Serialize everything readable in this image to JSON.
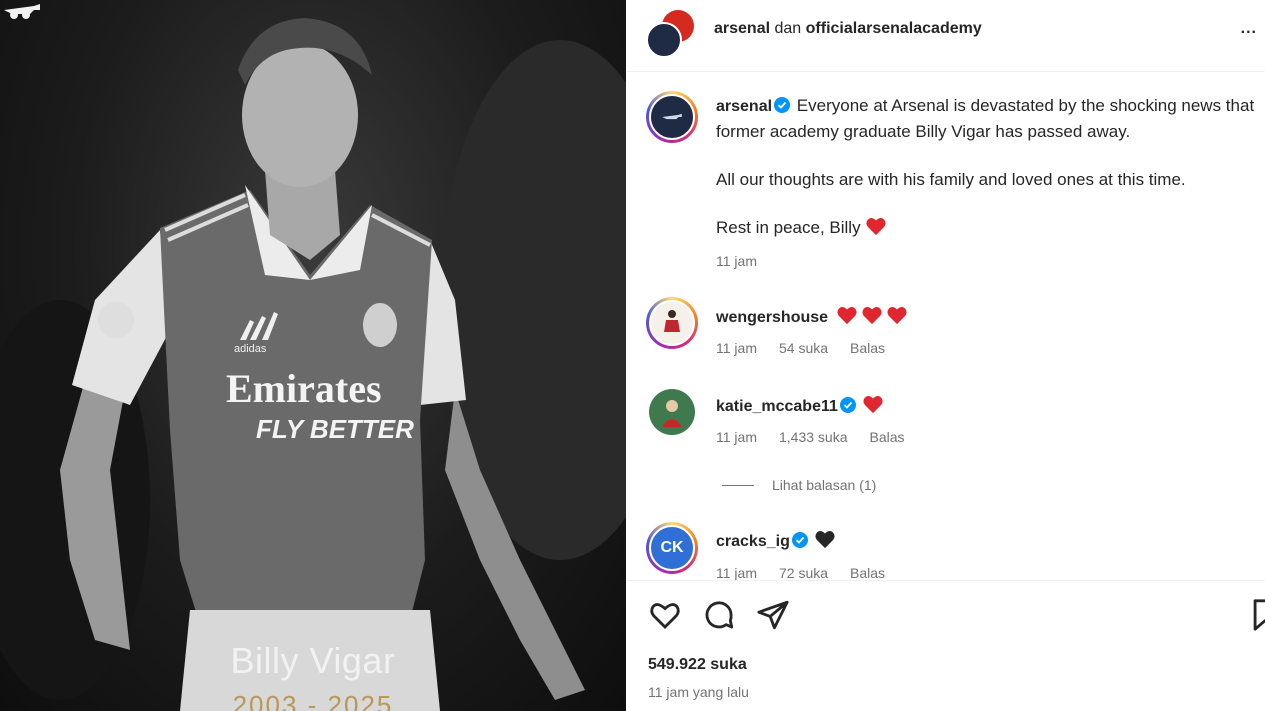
{
  "photo": {
    "name": "Billy Vigar",
    "years": "2003 - 2025",
    "shirt_sponsor_line1": "Emirates",
    "shirt_sponsor_line2": "FLY BETTER",
    "brand": "adidas"
  },
  "header": {
    "account1": "arsenal",
    "joiner": " dan ",
    "account2": "officialarsenalacademy",
    "more": "..."
  },
  "post": {
    "username": "arsenal",
    "text_p1": "Everyone at Arsenal is devastated by the shocking news that former academy graduate Billy Vigar has passed away.",
    "text_p2": "All our thoughts are with his family and loved ones at this time.",
    "text_p3": "Rest in peace, Billy",
    "time": "11 jam"
  },
  "comments": [
    {
      "username": "wengershouse",
      "time": "11 jam",
      "likes": "54 suka",
      "reply": "Balas",
      "hearts": 3,
      "heart_color": "#e0262e"
    },
    {
      "username": "katie_mccabe11",
      "time": "11 jam",
      "likes": "1,433 suka",
      "reply": "Balas",
      "hearts": 1,
      "heart_color": "#e0262e"
    },
    {
      "username": "cracks_ig",
      "time": "11 jam",
      "likes": "72 suka",
      "reply": "Balas",
      "hearts": 1,
      "heart_color": "#262626",
      "avatar_text": "CK"
    }
  ],
  "view_replies": "Lihat balasan (1)",
  "likes_count": "549.922 suka",
  "posted_ago": "11 jam yang lalu",
  "colors": {
    "verified": "#0095f6",
    "heart": "#e0262e",
    "years_gold": "#b89858"
  },
  "icons": [
    "heart-icon",
    "comment-icon",
    "share-icon",
    "save-icon",
    "verified-icon"
  ]
}
